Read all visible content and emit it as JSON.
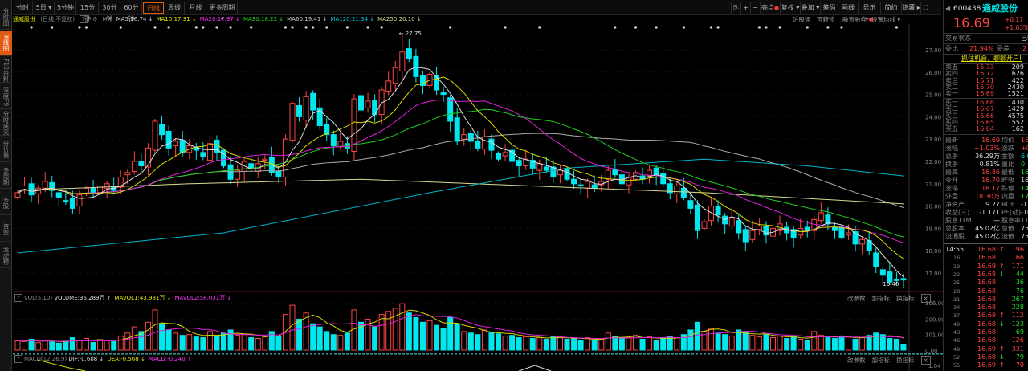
{
  "sidebar": {
    "tabs": [
      "分时图",
      "K线图",
      "F10资料",
      "深度F9",
      "分时成交",
      "分价表",
      "多周期",
      "多股",
      "资金",
      "龙虎榜"
    ],
    "active": 1
  },
  "toolbar": {
    "periods": [
      "分时",
      "5日 ▾",
      "5分钟",
      "15分钟",
      "30分钟",
      "60分钟",
      "日线",
      "周线",
      "月线",
      "更多周期 ▾"
    ],
    "active": 6,
    "right_icons": [
      "lock-icon",
      "zoom-in-icon",
      "zoom-out-icon"
    ],
    "right_buttons": [
      "亮点",
      "复权 ▾",
      "叠加 ▾",
      "筹码",
      "画线",
      "显示 ▾",
      "简约",
      "隐藏 ▸"
    ],
    "sub_links": [
      "沪股通",
      "可转债",
      "融资融券",
      "设置均线 ▾"
    ]
  },
  "legend": {
    "name": "通威股份",
    "mode": "(日线,不复权)",
    "help": "?",
    "ma_label": "MA",
    "items": [
      {
        "text": "MA5:16.74 ↓",
        "color": "#dddddd"
      },
      {
        "text": "MA10:17.31 ↓",
        "color": "#e8e800"
      },
      {
        "text": "MA20:17.97 ↓",
        "color": "#ff33ff"
      },
      {
        "text": "MA30:18.22 ↓",
        "color": "#22dd22"
      },
      {
        "text": "MA60:19.41 ↓",
        "color": "#cccccc"
      },
      {
        "text": "MA120:21.34 ↓",
        "color": "#00c8dd"
      },
      {
        "text": "MA250:20.10 ↓",
        "color": "#d8d890"
      }
    ]
  },
  "volume_legend": {
    "help": "?",
    "name": "VOL(5,10)",
    "items": [
      {
        "text": "VOLUME:36.289万 ↑",
        "color": "#dddddd"
      },
      {
        "text": "MAVOL1:43.981万 ↓",
        "color": "#e8e800"
      },
      {
        "text": "MAVOL2:58.031万 ↓",
        "color": "#ff33ff"
      }
    ]
  },
  "macd_legend": {
    "help": "?",
    "name": "MACD(12,26,9)",
    "items": [
      {
        "text": "DIF:-0.608 ↓",
        "color": "#dddddd"
      },
      {
        "text": "DEA:-0.568 ↓",
        "color": "#e8e800"
      },
      {
        "text": "MACD:-0.240 ↑",
        "color": "#ff33ff"
      }
    ]
  },
  "panel_buttons": [
    "改参数",
    "加指标",
    "换指标"
  ],
  "colors": {
    "up": "#ff4444",
    "down": "#00e8ee",
    "accent": "#e05a10"
  },
  "chart_data": {
    "type": "candlestick",
    "price_axis": {
      "ticks": [
        "27.00",
        "26.00",
        "25.00",
        "24.00",
        "23.00",
        "22.00",
        "21.00",
        "20.00",
        "19.00",
        "18.00",
        "17.00"
      ],
      "range": [
        17,
        27
      ]
    },
    "volume_axis": {
      "ticks": [
        "306.00",
        "200.00",
        "101.00",
        "0.00"
      ]
    },
    "macd_axis": {
      "ticks": [
        "1.04"
      ]
    },
    "high_label": "27.75",
    "high_index": 56,
    "low_label": "16.46",
    "closes": [
      20.6,
      20.9,
      20.5,
      20.8,
      21.1,
      20.7,
      20.4,
      20.2,
      19.9,
      20.5,
      20.8,
      20.6,
      20.9,
      21.0,
      20.7,
      21.3,
      21.5,
      22.0,
      21.8,
      22.6,
      23.8,
      23.2,
      22.6,
      22.9,
      22.4,
      22.7,
      22.5,
      22.2,
      22.8,
      22.4,
      21.8,
      21.2,
      21.6,
      22.0,
      21.7,
      21.9,
      22.1,
      21.5,
      21.3,
      23.0,
      24.6,
      24.0,
      24.9,
      24.3,
      23.6,
      23.2,
      22.7,
      22.9,
      22.6,
      24.8,
      24.3,
      24.7,
      24.1,
      25.2,
      25.6,
      26.2,
      26.9,
      26.6,
      25.8,
      25.4,
      25.9,
      25.2,
      25.0,
      23.8,
      22.9,
      23.2,
      22.9,
      22.6,
      23.1,
      22.5,
      22.1,
      22.4,
      22.0,
      21.8,
      22.1,
      21.7,
      21.9,
      21.6,
      21.3,
      21.6,
      21.2,
      21.0,
      20.9,
      21.1,
      20.8,
      21.1,
      21.6,
      21.4,
      21.0,
      21.3,
      21.5,
      21.2,
      21.6,
      21.4,
      21.0,
      20.6,
      20.9,
      20.4,
      19.9,
      18.9,
      19.3,
      20.0,
      19.6,
      19.2,
      19.5,
      18.8,
      18.4,
      18.9,
      19.1,
      18.7,
      19.0,
      19.2,
      18.8,
      18.6,
      19.0,
      18.9,
      19.4,
      19.7,
      19.2,
      18.9,
      18.6,
      18.8,
      18.3,
      18.5,
      18.0,
      17.3,
      16.9,
      16.6,
      16.7,
      16.69
    ],
    "volumes": [
      60,
      55,
      70,
      48,
      65,
      52,
      45,
      58,
      80,
      62,
      75,
      50,
      68,
      60,
      55,
      90,
      110,
      150,
      120,
      180,
      260,
      170,
      130,
      110,
      95,
      100,
      85,
      80,
      120,
      90,
      110,
      130,
      95,
      100,
      80,
      75,
      85,
      120,
      90,
      230,
      290,
      200,
      240,
      170,
      150,
      120,
      100,
      95,
      110,
      260,
      180,
      200,
      150,
      230,
      250,
      270,
      300,
      240,
      210,
      180,
      190,
      160,
      140,
      210,
      170,
      120,
      110,
      100,
      130,
      115,
      105,
      90,
      95,
      80,
      85,
      75,
      80,
      70,
      90,
      85,
      70,
      75,
      60,
      80,
      65,
      70,
      110,
      90,
      75,
      80,
      95,
      70,
      85,
      60,
      75,
      90,
      80,
      100,
      130,
      180,
      120,
      140,
      110,
      100,
      90,
      130,
      115,
      95,
      85,
      100,
      80,
      90,
      75,
      85,
      70,
      65,
      120,
      95,
      80,
      75,
      90,
      85,
      70,
      80,
      95,
      110,
      100,
      75,
      70,
      36.29
    ],
    "ma120": [
      [
        0,
        17.9
      ],
      [
        30,
        18.8
      ],
      [
        60,
        20.6
      ],
      [
        80,
        21.7
      ],
      [
        100,
        22.1
      ],
      [
        115,
        21.8
      ],
      [
        129,
        21.35
      ]
    ],
    "ma250": [
      [
        0,
        20.7
      ],
      [
        25,
        21.0
      ],
      [
        50,
        21.2
      ],
      [
        75,
        20.9
      ],
      [
        100,
        20.6
      ],
      [
        129,
        20.1
      ]
    ],
    "event_markers": [
      2,
      5,
      9,
      10,
      15,
      20,
      22,
      26,
      27,
      29,
      31,
      34,
      39,
      40,
      42,
      43,
      45,
      48,
      51,
      53,
      63,
      71,
      76,
      87,
      90,
      93,
      97,
      101,
      102,
      108,
      109,
      111,
      115,
      118,
      120,
      128
    ]
  },
  "quote": {
    "code": "600438",
    "name": "通威股份",
    "price": "16.69",
    "change": "+0.17",
    "change_pct": "+1.03%",
    "status_label": "交易状态",
    "status_value": "已收",
    "wb_label": "委比",
    "wb_value": "21.94%",
    "wc_label": "委差",
    "wc_value": "2",
    "promo": "抓住机会，聊聊开户!",
    "asks": [
      {
        "label": "卖五",
        "price": "16.73",
        "vol": "209"
      },
      {
        "label": "卖四",
        "price": "16.72",
        "vol": "626"
      },
      {
        "label": "卖三",
        "price": "16.71",
        "vol": "422"
      },
      {
        "label": "卖二",
        "price": "16.70",
        "vol": "2430"
      },
      {
        "label": "卖一",
        "price": "16.69",
        "vol": "1521"
      }
    ],
    "bids": [
      {
        "label": "买一",
        "price": "16.68",
        "vol": "430"
      },
      {
        "label": "买二",
        "price": "16.67",
        "vol": "1429"
      },
      {
        "label": "买三",
        "price": "16.66",
        "vol": "4575"
      },
      {
        "label": "买四",
        "price": "16.65",
        "vol": "1552"
      },
      {
        "label": "买五",
        "price": "16.64",
        "vol": "162"
      }
    ],
    "stats": [
      {
        "l1": "最新",
        "v1": "16.69",
        "c1": "red",
        "l2": "均价",
        "v2": "16",
        "c2": "red"
      },
      {
        "l1": "涨幅",
        "v1": "+1.03%",
        "c1": "red",
        "l2": "涨跌",
        "v2": "+0",
        "c2": "red"
      },
      {
        "l1": "总手",
        "v1": "36.29万",
        "c1": "wh",
        "l2": "金额",
        "v2": "6.0",
        "c2": "cy"
      },
      {
        "l1": "换手",
        "v1": "0.81%",
        "c1": "wh",
        "l2": "量比",
        "v2": "0",
        "c2": "grn"
      },
      {
        "l1": "最高",
        "v1": "16.86",
        "c1": "red",
        "l2": "最低",
        "v2": "16",
        "c2": "grn"
      },
      {
        "l1": "今开",
        "v1": "16.70",
        "c1": "red",
        "l2": "昨收",
        "v2": "16",
        "c2": "wh"
      },
      {
        "l1": "涨停",
        "v1": "18.17",
        "c1": "red",
        "l2": "跌停",
        "v2": "14",
        "c2": "grn"
      },
      {
        "l1": "外盘",
        "v1": "18.30万",
        "c1": "red",
        "l2": "内盘",
        "v2": "17.9",
        "c2": "grn"
      },
      {
        "l1": "净资产",
        "v1": "9.27",
        "c1": "wh",
        "l2": "ROE",
        "v2": "-11.4",
        "c2": "wh"
      },
      {
        "l1": "收益(三)",
        "v1": "-1.171",
        "c1": "wh",
        "l2": "PE(动)",
        "v2": "-10",
        "c2": "wh"
      },
      {
        "l1": "股息TTM",
        "v1": "—",
        "c1": "wh",
        "l2": "股息率TTM",
        "v2": "",
        "c2": "wh"
      },
      {
        "l1": "总股本",
        "v1": "45.02亿",
        "c1": "wh",
        "l2": "总值",
        "v2": "751.",
        "c2": "wh"
      },
      {
        "l1": "流通股",
        "v1": "45.02亿",
        "c1": "wh",
        "l2": "流值",
        "v2": "751.",
        "c2": "wh"
      }
    ],
    "trades": [
      {
        "t": "14:55",
        "p": "16.68",
        "a": "↑",
        "ac": "red",
        "v": "196",
        "vc": "red"
      },
      {
        "t": "16",
        "p": "16.68",
        "a": "",
        "ac": "",
        "v": "66",
        "vc": "red"
      },
      {
        "t": "19",
        "p": "16.69",
        "a": "↑",
        "ac": "red",
        "v": "171",
        "vc": "red"
      },
      {
        "t": "22",
        "p": "16.68",
        "a": "↓",
        "ac": "grn",
        "v": "44",
        "vc": "grn"
      },
      {
        "t": "25",
        "p": "16.68",
        "a": "",
        "ac": "",
        "v": "36",
        "vc": "grn"
      },
      {
        "t": "28",
        "p": "16.68",
        "a": "",
        "ac": "",
        "v": "76",
        "vc": "grn"
      },
      {
        "t": "31",
        "p": "16.68",
        "a": "",
        "ac": "",
        "v": "267",
        "vc": "grn"
      },
      {
        "t": "34",
        "p": "16.68",
        "a": "",
        "ac": "",
        "v": "228",
        "vc": "grn"
      },
      {
        "t": "37",
        "p": "16.69",
        "a": "↑",
        "ac": "red",
        "v": "112",
        "vc": "red"
      },
      {
        "t": "40",
        "p": "16.68",
        "a": "↓",
        "ac": "grn",
        "v": "123",
        "vc": "grn"
      },
      {
        "t": "43",
        "p": "16.68",
        "a": "",
        "ac": "",
        "v": "69",
        "vc": "grn"
      },
      {
        "t": "46",
        "p": "16.68",
        "a": "",
        "ac": "",
        "v": "126",
        "vc": "red"
      },
      {
        "t": "49",
        "p": "16.69",
        "a": "↑",
        "ac": "red",
        "v": "331",
        "vc": "red"
      },
      {
        "t": "52",
        "p": "16.68",
        "a": "↓",
        "ac": "grn",
        "v": "79",
        "vc": "grn"
      },
      {
        "t": "55",
        "p": "16.69",
        "a": "↑",
        "ac": "red",
        "v": "70",
        "vc": "red"
      }
    ]
  }
}
